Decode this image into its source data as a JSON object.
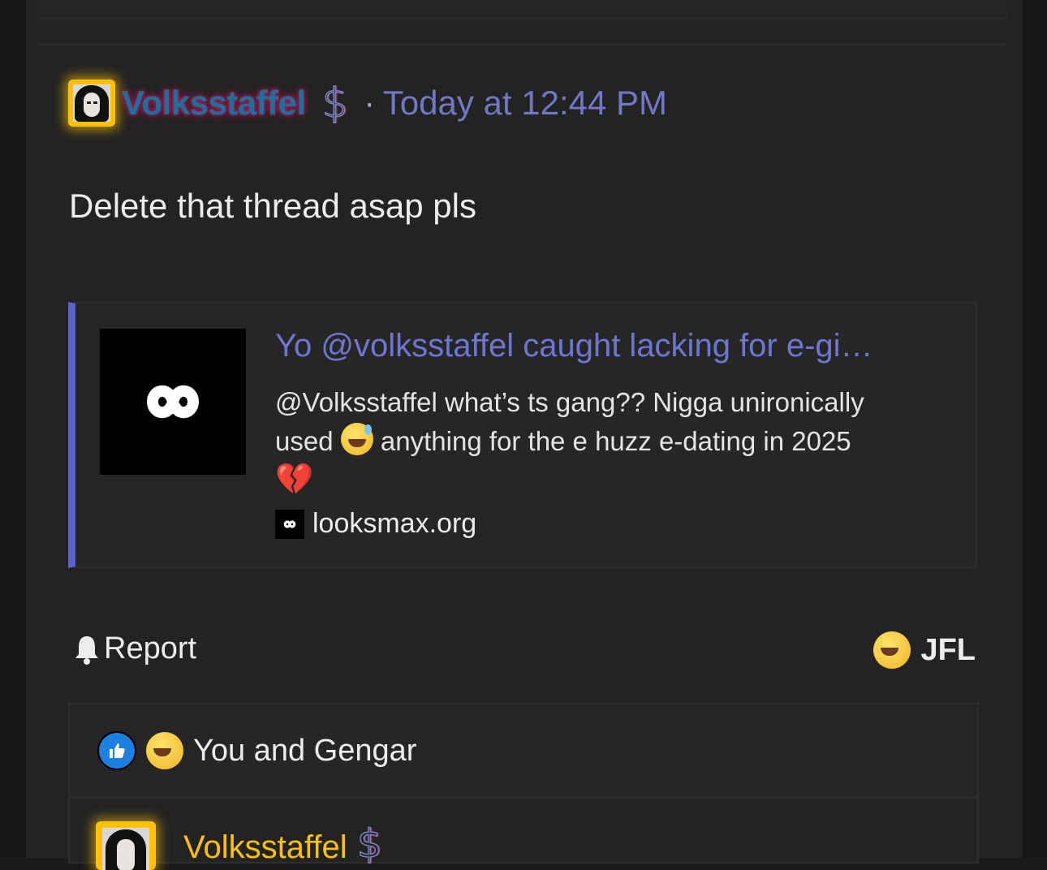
{
  "post": {
    "username": "Volksstaffel",
    "badge_glyph": "$",
    "separator": "·",
    "timestamp": "Today at 12:44 PM",
    "message": "Delete that thread asap pls"
  },
  "embed": {
    "title": "Yo @volksstaffel caught lacking for e-gi…",
    "description_line1": "@Volksstaffel what’s ts gang?? Nigga unironically",
    "description_used": "used",
    "description_rest": "anything for the e huzz e-dating in 2025",
    "heart_glyph": "💔",
    "source": "looksmax.org",
    "accent_color": "#5c63c7"
  },
  "actions": {
    "report_label": "Report",
    "reaction_label": "JFL"
  },
  "reactions": {
    "names": "You and Gengar"
  },
  "reply": {
    "username": "Volksstaffel",
    "badge_glyph": "$"
  },
  "icons": {
    "bell": "bell-icon",
    "like": "like-icon",
    "laughing": "laughing-crying-emoji",
    "sweat": "sweat-smile-emoji",
    "broken_heart": "broken-heart-emoji"
  }
}
